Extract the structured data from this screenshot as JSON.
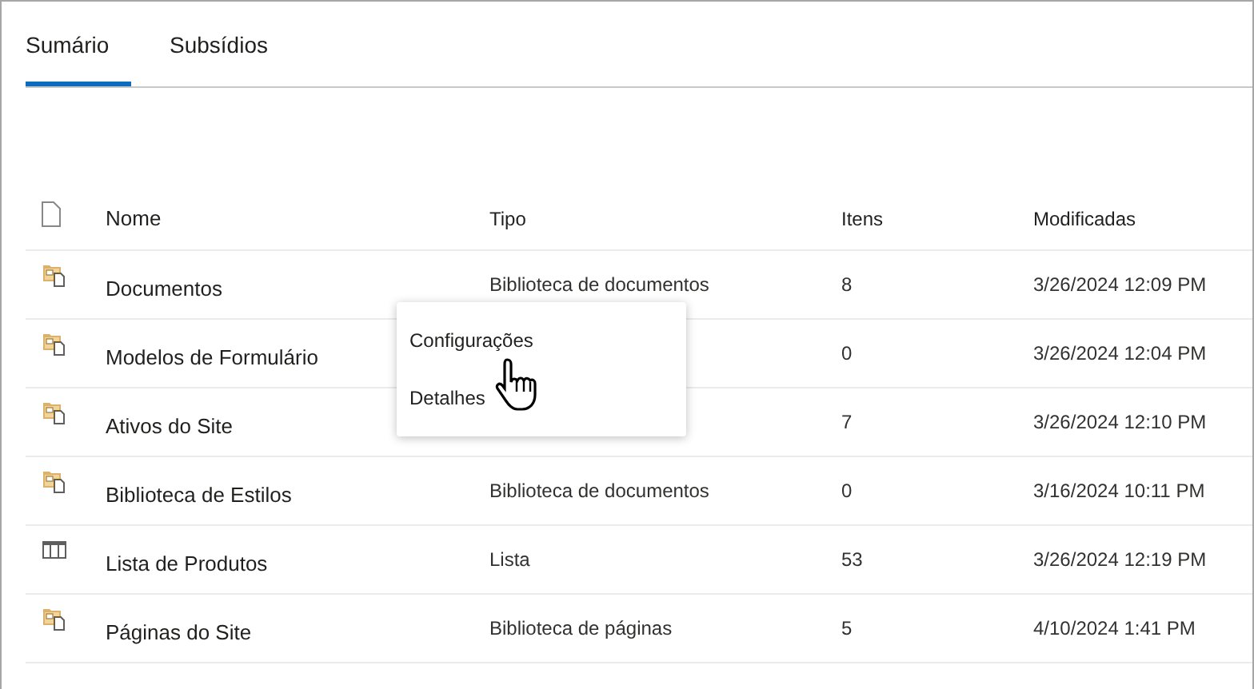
{
  "tabs": [
    {
      "label": "Sumário",
      "selected": true
    },
    {
      "label": "Subsídios",
      "selected": false
    }
  ],
  "table": {
    "columns": [
      "Nome",
      "Tipo",
      "Itens",
      "Modificadas"
    ],
    "rows": [
      {
        "kind": "library",
        "name": "Documentos",
        "type": "Biblioteca de documentos",
        "items": "8",
        "modified": "3/26/2024 12:09 PM"
      },
      {
        "kind": "library",
        "name": "Modelos de Formulário",
        "type": "",
        "items": "0",
        "modified": "3/26/2024 12:04 PM"
      },
      {
        "kind": "library",
        "name": "Ativos do Site",
        "type": "",
        "items": "7",
        "modified": "3/26/2024 12:10 PM"
      },
      {
        "kind": "library",
        "name": "Biblioteca de Estilos",
        "type": "Biblioteca de documentos",
        "items": "0",
        "modified": "3/16/2024 10:11 PM"
      },
      {
        "kind": "list",
        "name": "Lista de Produtos",
        "type": "Lista",
        "items": "53",
        "modified": "3/26/2024 12:19 PM"
      },
      {
        "kind": "library",
        "name": "Páginas do Site",
        "type": "Biblioteca de páginas",
        "items": "5",
        "modified": "4/10/2024 1:41 PM"
      }
    ]
  },
  "context_menu": {
    "items": [
      "Configurações",
      "Detalhes"
    ]
  }
}
